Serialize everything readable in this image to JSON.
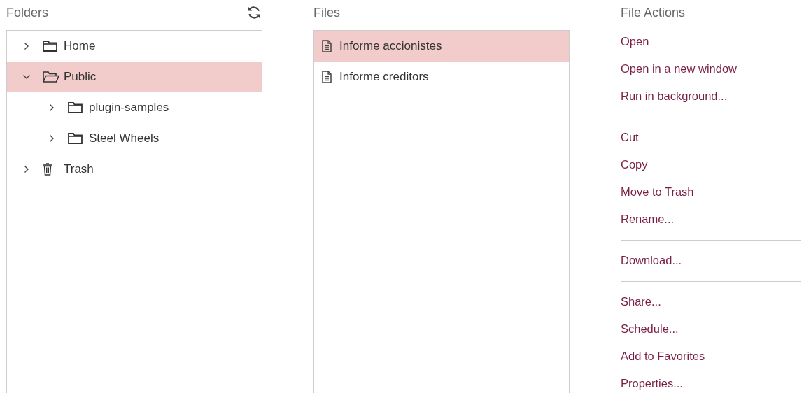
{
  "folders": {
    "title": "Folders",
    "items": [
      {
        "label": "Home",
        "kind": "folder",
        "expanded": false,
        "selected": false
      },
      {
        "label": "Public",
        "kind": "folder",
        "expanded": true,
        "selected": true,
        "children": [
          {
            "label": "plugin-samples",
            "kind": "folder",
            "expanded": false,
            "selected": false
          },
          {
            "label": "Steel Wheels",
            "kind": "folder",
            "expanded": false,
            "selected": false
          }
        ]
      },
      {
        "label": "Trash",
        "kind": "trash",
        "expanded": false,
        "selected": false
      }
    ]
  },
  "files": {
    "title": "Files",
    "items": [
      {
        "label": "Informe accionistes",
        "selected": true
      },
      {
        "label": "Informe creditors",
        "selected": false
      }
    ]
  },
  "file_actions": {
    "title": "File Actions",
    "groups": [
      [
        "Open",
        "Open in a new window",
        "Run in background..."
      ],
      [
        "Cut",
        "Copy",
        "Move to Trash",
        "Rename..."
      ],
      [
        "Download..."
      ],
      [
        "Share...",
        "Schedule...",
        "Add to Favorites",
        "Properties..."
      ]
    ]
  }
}
